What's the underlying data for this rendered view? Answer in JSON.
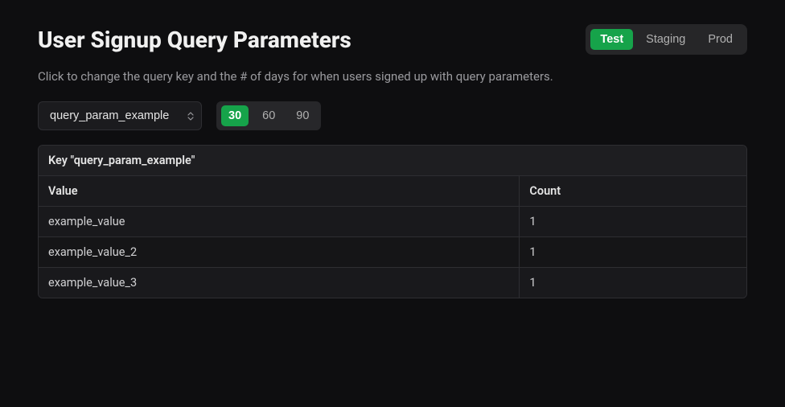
{
  "header": {
    "title": "User Signup Query Parameters",
    "env_tabs": [
      "Test",
      "Staging",
      "Prod"
    ],
    "active_env": "Test"
  },
  "subtitle": "Click to change the query key and the # of days for when users signed up with query parameters.",
  "controls": {
    "query_select": {
      "selected": "query_param_example",
      "options": [
        "query_param_example"
      ]
    },
    "days_tabs": [
      "30",
      "60",
      "90"
    ],
    "active_days": "30"
  },
  "table": {
    "key_label": "Key \"query_param_example\"",
    "columns": [
      "Value",
      "Count"
    ],
    "rows": [
      {
        "value": "example_value",
        "count": "1"
      },
      {
        "value": "example_value_2",
        "count": "1"
      },
      {
        "value": "example_value_3",
        "count": "1"
      }
    ]
  }
}
